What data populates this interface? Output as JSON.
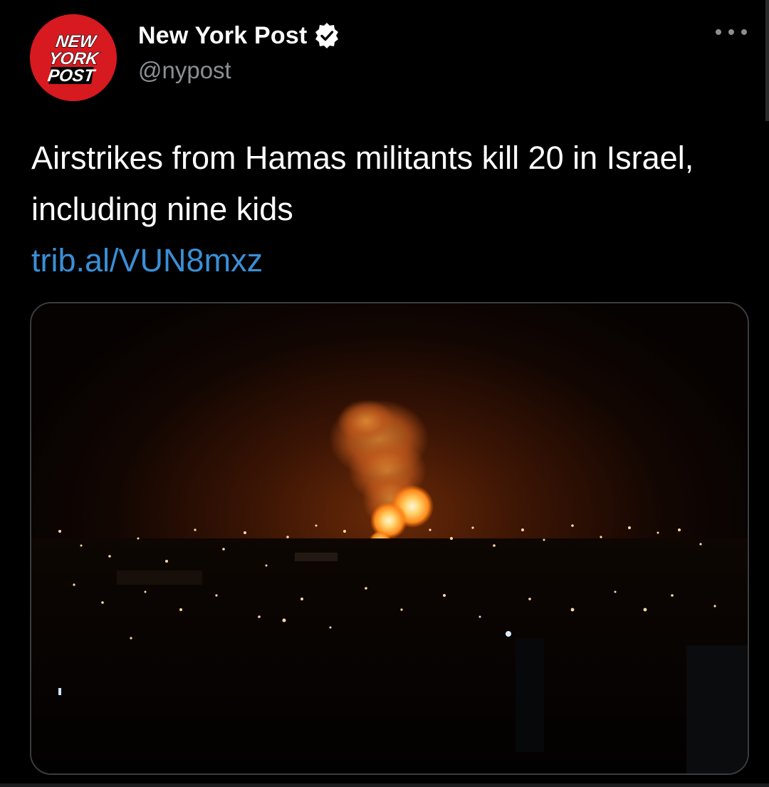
{
  "tweet": {
    "avatar_logo_text": [
      "NEW",
      "YORK",
      "POST"
    ],
    "display_name": "New York Post",
    "verified_icon": "verified-badge-icon",
    "handle": "@nypost",
    "more_icon": "more-options-icon",
    "text": "Airstrikes from Hamas militants kill 20 in Israel, including nine kids",
    "link": "trib.al/VUN8mxz"
  },
  "media": {
    "kind": "photo",
    "subject": "night-explosion-city"
  },
  "colors": {
    "background": "#000000",
    "brand_red": "#d71920",
    "link_blue": "#3a8fd6",
    "secondary_text": "#8b8f94",
    "verified_blue": "#ffffff"
  }
}
